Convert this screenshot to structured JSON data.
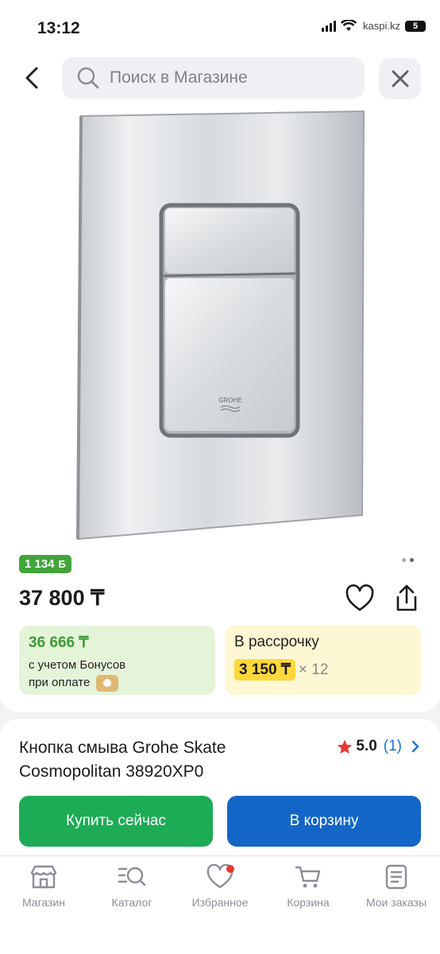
{
  "status_bar": {
    "time": "13:12",
    "watermark": "kaspi.kz",
    "battery": "5"
  },
  "search": {
    "placeholder": "Поиск в Магазине"
  },
  "product": {
    "image_brand_text": "GROHE",
    "bonus": {
      "amount": "1 134",
      "symbol": "Б"
    },
    "price": "37 800 ₸",
    "bonus_price": {
      "amount": "36 666 ₸",
      "line1": "с учетом Бонусов",
      "line2": "при оплате"
    },
    "installment": {
      "label": "В рассрочку",
      "amount": "3 150 ₸",
      "multiplier": "× 12"
    },
    "gallery": {
      "total": 2,
      "current": 2
    }
  },
  "info": {
    "title": "Кнопка смыва Grohe Skate Cosmopolitan 38920XP0",
    "rating": {
      "score": "5.0",
      "count": "(1)"
    },
    "buy_label": "Купить сейчас",
    "cart_label": "В корзину"
  },
  "tabs": [
    {
      "label": "Магазин",
      "icon": "store-icon"
    },
    {
      "label": "Каталог",
      "icon": "catalog-search-icon"
    },
    {
      "label": "Избранное",
      "icon": "heart-icon",
      "badge": true
    },
    {
      "label": "Корзина",
      "icon": "cart-icon"
    },
    {
      "label": "Мои заказы",
      "icon": "orders-icon"
    }
  ],
  "colors": {
    "buy": "#1eab55",
    "cart": "#1466c6",
    "bonus": "#43a43b",
    "installment_pill": "#ffd83a",
    "link": "#1a73d8"
  }
}
